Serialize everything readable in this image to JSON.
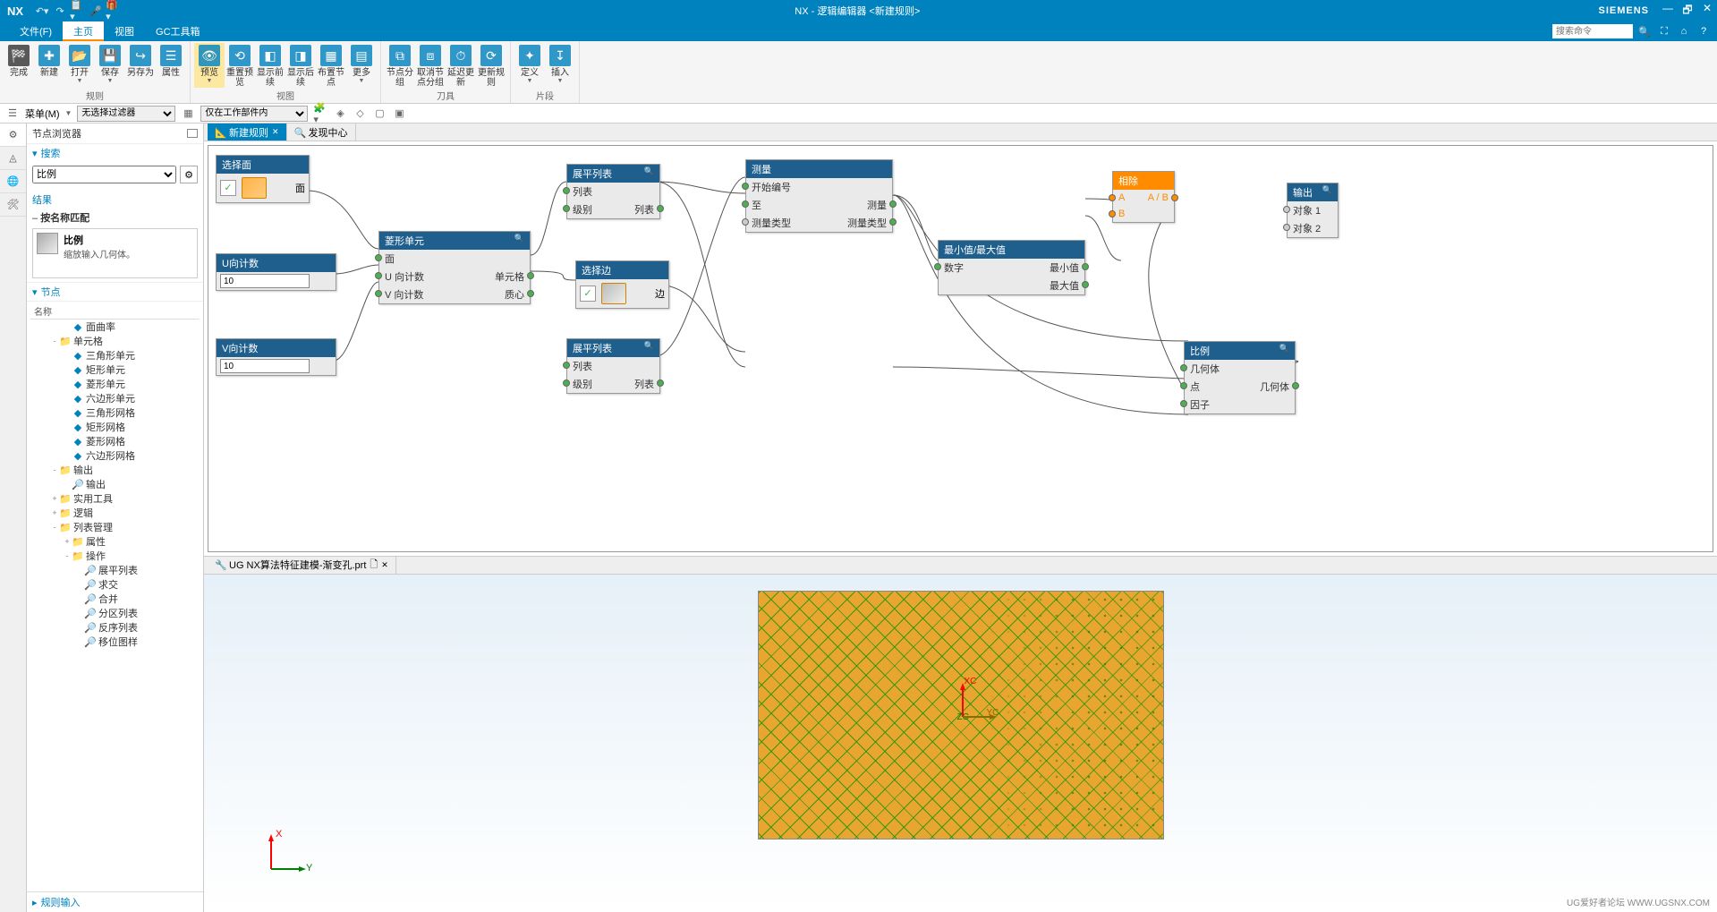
{
  "titlebar": {
    "app": "NX",
    "title": "NX - 逻辑编辑器 <新建规则>",
    "brand": "SIEMENS"
  },
  "menu": {
    "file": "文件(F)",
    "home": "主页",
    "view": "视图",
    "gc": "GC工具箱",
    "search_placeholder": "搜索命令"
  },
  "ribbon": {
    "groups": {
      "rule": {
        "label": "规则",
        "btns": [
          "完成",
          "新建",
          "打开",
          "保存",
          "另存为",
          "属性"
        ]
      },
      "view": {
        "label": "视图",
        "btns": [
          "预览",
          "重置预览",
          "显示前续",
          "显示后续",
          "布置节点",
          "更多"
        ]
      },
      "tool": {
        "label": "刀具",
        "btns": [
          "节点分组",
          "取消节点分组",
          "延迟更新",
          "更新规则"
        ]
      },
      "segment": {
        "label": "片段",
        "btns": [
          "定义",
          "插入"
        ]
      }
    }
  },
  "filterbar": {
    "menu": "菜单(M)",
    "sel_filter": "无选择过滤器",
    "scope": "仅在工作部件内"
  },
  "sidepanel": {
    "title": "节点浏览器",
    "search_label": "搜索",
    "search_value": "比例",
    "results_label": "结果",
    "match_header": "按名称匹配",
    "match_name": "比例",
    "match_desc": "缩放输入几何体。",
    "nodes_label": "节点",
    "tree_col": "名称",
    "tree": [
      {
        "indent": 2,
        "icon": "node",
        "label": "面曲率"
      },
      {
        "indent": 1,
        "icon": "folder",
        "exp": "-",
        "label": "单元格"
      },
      {
        "indent": 2,
        "icon": "node",
        "label": "三角形单元"
      },
      {
        "indent": 2,
        "icon": "node",
        "label": "矩形单元"
      },
      {
        "indent": 2,
        "icon": "node",
        "label": "菱形单元"
      },
      {
        "indent": 2,
        "icon": "node",
        "label": "六边形单元"
      },
      {
        "indent": 2,
        "icon": "node",
        "label": "三角形网格"
      },
      {
        "indent": 2,
        "icon": "node",
        "label": "矩形网格"
      },
      {
        "indent": 2,
        "icon": "node",
        "label": "菱形网格"
      },
      {
        "indent": 2,
        "icon": "node",
        "label": "六边形网格"
      },
      {
        "indent": 1,
        "icon": "folder",
        "exp": "-",
        "label": "输出"
      },
      {
        "indent": 2,
        "icon": "out",
        "label": "输出"
      },
      {
        "indent": 1,
        "icon": "folder",
        "exp": "+",
        "label": "实用工具"
      },
      {
        "indent": 1,
        "icon": "folder",
        "exp": "+",
        "label": "逻辑"
      },
      {
        "indent": 1,
        "icon": "folder",
        "exp": "-",
        "label": "列表管理"
      },
      {
        "indent": 2,
        "icon": "folder",
        "exp": "+",
        "label": "属性"
      },
      {
        "indent": 2,
        "icon": "folder",
        "exp": "-",
        "label": "操作"
      },
      {
        "indent": 3,
        "icon": "out",
        "label": "展平列表"
      },
      {
        "indent": 3,
        "icon": "out",
        "label": "求交"
      },
      {
        "indent": 3,
        "icon": "out",
        "label": "合并"
      },
      {
        "indent": 3,
        "icon": "out",
        "label": "分区列表"
      },
      {
        "indent": 3,
        "icon": "out",
        "label": "反序列表"
      },
      {
        "indent": 3,
        "icon": "out",
        "label": "移位图样"
      }
    ],
    "footer": "规则输入"
  },
  "tabs": {
    "t1": "新建规则",
    "t2": "发现中心"
  },
  "preview_tab": "UG NX算法特征建模-渐变孔.prt",
  "graph": {
    "select_face": {
      "title": "选择面",
      "out": "面"
    },
    "u_count": {
      "title": "U向计数",
      "value": "10"
    },
    "v_count": {
      "title": "V向计数",
      "value": "10"
    },
    "diamond_unit": {
      "title": "菱形单元",
      "in1": "面",
      "in2": "U 向计数",
      "in3": "V 向计数",
      "out1": "单元格",
      "out2": "质心"
    },
    "flat_list_1": {
      "title": "展平列表",
      "in1": "列表",
      "in2": "级别",
      "out": "列表"
    },
    "flat_list_2": {
      "title": "展平列表",
      "in1": "列表",
      "in2": "级别",
      "out": "列表"
    },
    "select_edge": {
      "title": "选择边",
      "out": "边"
    },
    "measure": {
      "title": "测量",
      "in1": "开始编号",
      "in2": "至",
      "in3": "测量类型",
      "out1": "测量",
      "out2": "测量类型"
    },
    "minmax": {
      "title": "最小值/最大值",
      "in": "数字",
      "out1": "最小值",
      "out2": "最大值"
    },
    "divide": {
      "title": "相除",
      "inA": "A",
      "inB": "B",
      "out": "A / B"
    },
    "scale": {
      "title": "比例",
      "in1": "几何体",
      "in2": "点",
      "in3": "因子",
      "out": "几何体"
    },
    "output": {
      "title": "输出",
      "o1": "对象 1",
      "o2": "对象 2"
    }
  },
  "axis": {
    "x": "X",
    "y": "Y",
    "xc": "XC",
    "yc": "YC",
    "zc": "ZC"
  },
  "watermark": "UG爱好者论坛  WWW.UGSNX.COM"
}
